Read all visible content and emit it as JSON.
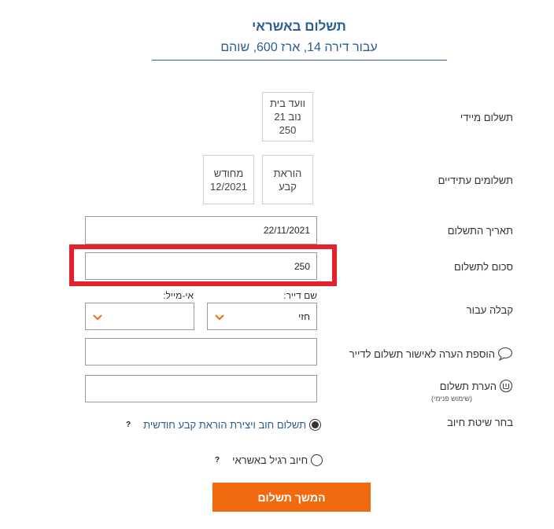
{
  "header": {
    "title": "תשלום באשראי",
    "subtitle": "עבור דירה 14, ארז 600, שוהם"
  },
  "immediate_payment": {
    "label": "תשלום מיידי",
    "card": {
      "line1": "וועד בית",
      "line2": "נוב 21",
      "line3": "250"
    }
  },
  "future_payments": {
    "label": "תשלומים עתידיים",
    "cards": [
      {
        "line1": "הוראת",
        "line2": "קבע"
      },
      {
        "line1": "מחודש",
        "line2": "12/2021"
      }
    ]
  },
  "payment_date": {
    "label": "תאריך התשלום",
    "value": "22/11/2021"
  },
  "payment_amount": {
    "label": "סכום לתשלום",
    "value": "250"
  },
  "receipt": {
    "label": "קבלה עבור",
    "tenant_name_label": "שם דייר:",
    "tenant_name_value": "חזי",
    "email_label": "אי-מייל:",
    "email_value": ""
  },
  "tenant_note": {
    "label": "הוספת הערה לאישור תשלום לדייר",
    "value": ""
  },
  "payment_note": {
    "label": "הערת תשלום",
    "sublabel": "(שימוש פנימי)",
    "value": ""
  },
  "charge_method": {
    "label": "בחר שיטת חיוב",
    "options": [
      {
        "label": "תשלום חוב ויצירת הוראת קבע חודשית",
        "selected": true,
        "help": "?"
      },
      {
        "label": "חיוב רגיל באשראי",
        "selected": false,
        "help": "?"
      }
    ]
  },
  "submit": {
    "label": "המשך תשלום"
  },
  "colors": {
    "accent": "#f26a10",
    "brand": "#2a5f8f",
    "highlight": "#e3202b"
  },
  "icons": {
    "chevron": "chevron-down-icon",
    "speech": "speech-bubble-icon",
    "payment_note": "payment-note-icon"
  }
}
